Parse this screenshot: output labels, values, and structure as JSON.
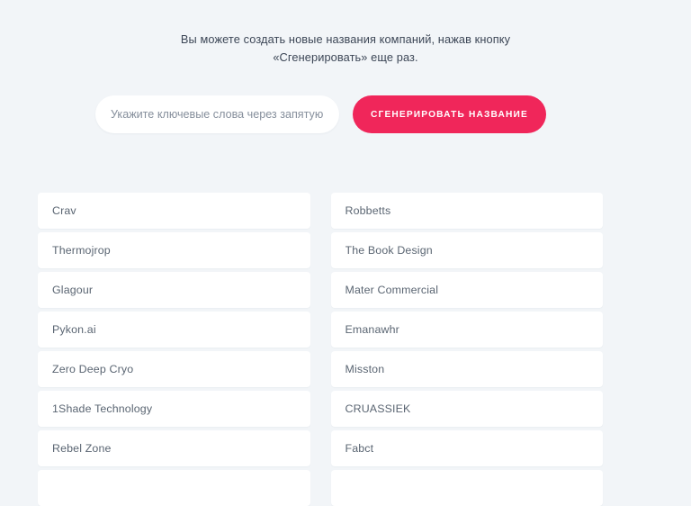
{
  "intro": {
    "line1": "Вы можете создать новые названия компаний, нажав кнопку",
    "line2": "«Сгенерировать» еще раз."
  },
  "form": {
    "input_placeholder": "Укажите ключевые слова через запятую",
    "input_value": "",
    "generate_label": "СГЕНЕРИРОВАТЬ НАЗВАНИЕ"
  },
  "colors": {
    "page_background": "#f2f5f8",
    "accent": "#f0265a",
    "card_background": "#ffffff",
    "heading_text": "#3c4656",
    "body_text": "#5a6572"
  },
  "results": {
    "left_column": [
      {
        "name": "Crav"
      },
      {
        "name": "Thermojrop"
      },
      {
        "name": "Glagour"
      },
      {
        "name": "Pykon.ai"
      },
      {
        "name": "Zero Deep Cryo"
      },
      {
        "name": "1Shade Technology"
      },
      {
        "name": "Rebel Zone"
      },
      {
        "name": ""
      }
    ],
    "right_column": [
      {
        "name": "Robbetts"
      },
      {
        "name": "The Book Design"
      },
      {
        "name": "Mater Commercial"
      },
      {
        "name": "Emanawhr"
      },
      {
        "name": "Misston"
      },
      {
        "name": "CRUASSIEK"
      },
      {
        "name": "Fabct"
      },
      {
        "name": ""
      }
    ]
  }
}
